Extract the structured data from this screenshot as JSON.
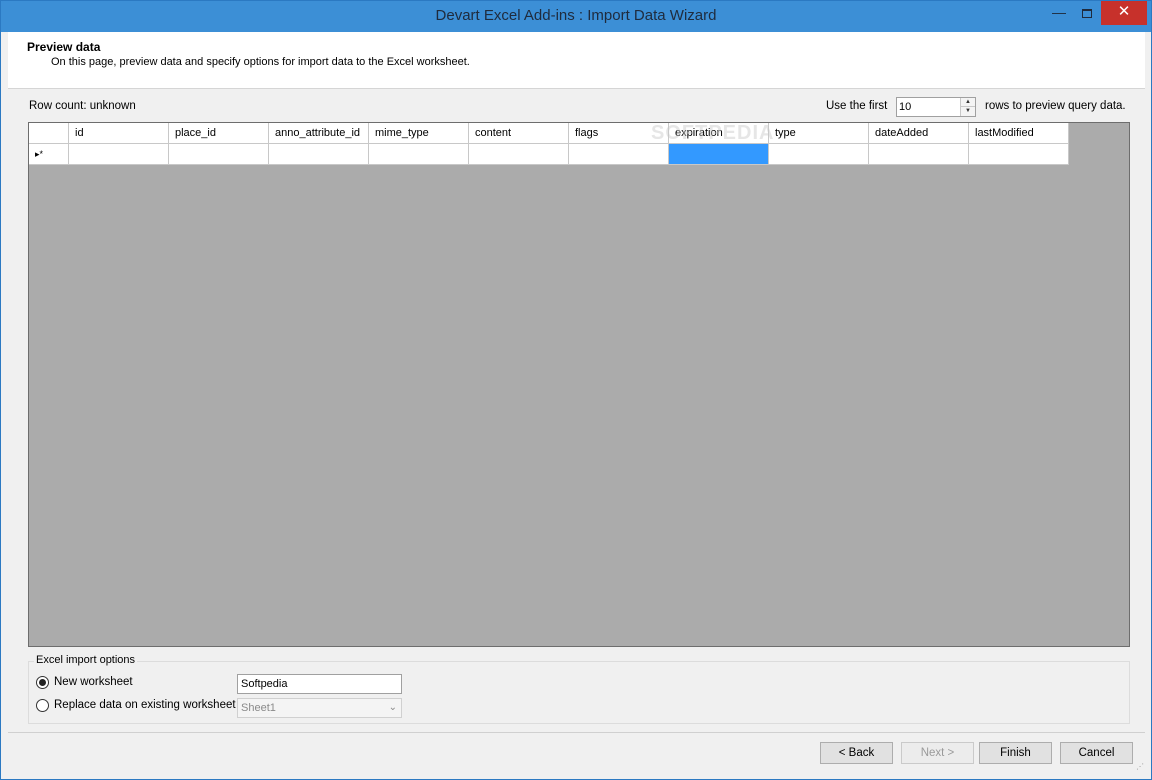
{
  "window": {
    "title": "Devart Excel Add-ins : Import Data Wizard",
    "minimize": "—",
    "close": "✕"
  },
  "header": {
    "title": "Preview data",
    "description": "On this page, preview data and specify options for import data to the Excel worksheet."
  },
  "preview": {
    "row_count": "Row count: unknown",
    "use_first_label": "Use the first",
    "rows_value": "10",
    "rows_suffix": "rows to preview query data."
  },
  "grid": {
    "columns": [
      "id",
      "place_id",
      "anno_attribute_id",
      "mime_type",
      "content",
      "flags",
      "expiration",
      "type",
      "dateAdded",
      "lastModified"
    ],
    "new_row_marker": "▸*",
    "selected_column": "expiration"
  },
  "watermark": "SOFTPEDIA",
  "import_options": {
    "legend": "Excel import options",
    "new_worksheet": "New worksheet",
    "replace_existing": "Replace data on existing worksheet",
    "worksheet_name": "Softpedia",
    "existing_sheet": "Sheet1",
    "selected": "new_worksheet"
  },
  "buttons": {
    "back": "< Back",
    "next": "Next >",
    "finish": "Finish",
    "cancel": "Cancel"
  },
  "colors": {
    "titlebar": "#3c8fd6",
    "close": "#c7312b",
    "selection": "#3399ff",
    "grid_background": "#ababab"
  }
}
